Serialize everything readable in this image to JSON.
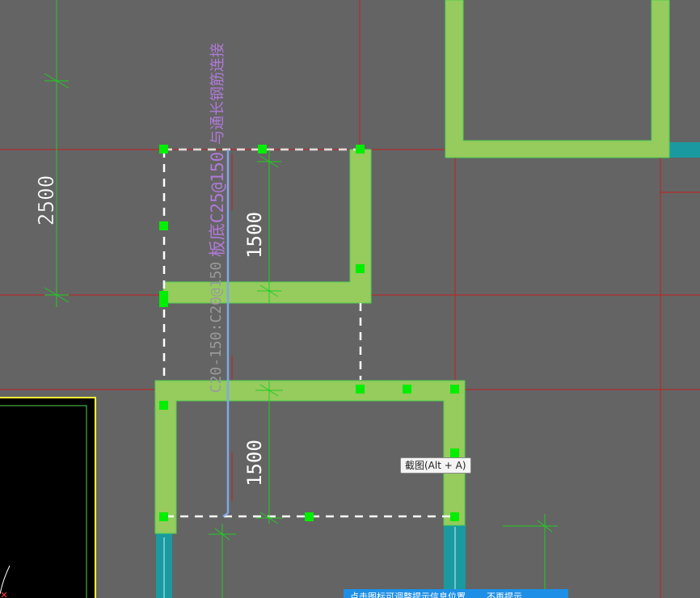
{
  "annotations": {
    "rebar_note": "与通长钢筋连接",
    "slab_rebar_spec": "板底C25@150",
    "wall_rebar_spec": "C20-150:C20@150"
  },
  "dimensions": {
    "height_left": "2500",
    "height_upper": "1500",
    "height_lower": "1500"
  },
  "tooltip": {
    "label": "截图(Alt + A)"
  },
  "hint_bar": {
    "message": "点击图标可调整提示信息位置",
    "dismiss": "不再提示"
  },
  "colors": {
    "background": "#646464",
    "grid_line": "#c81e1e",
    "dimension_line": "#22cc22",
    "wall_fill": "#96cb5e",
    "grip": "#00ee00",
    "selection_dash": "#ffffff",
    "rebar_line": "#7fa8e8",
    "cyan_wall": "#1a9aa0",
    "annotation_purple": "#b07ad8",
    "annotation_gray": "#9a9a9a",
    "tooltip_bg": "#f4f4f4",
    "hint_bar_bg": "#1e8fe6"
  }
}
